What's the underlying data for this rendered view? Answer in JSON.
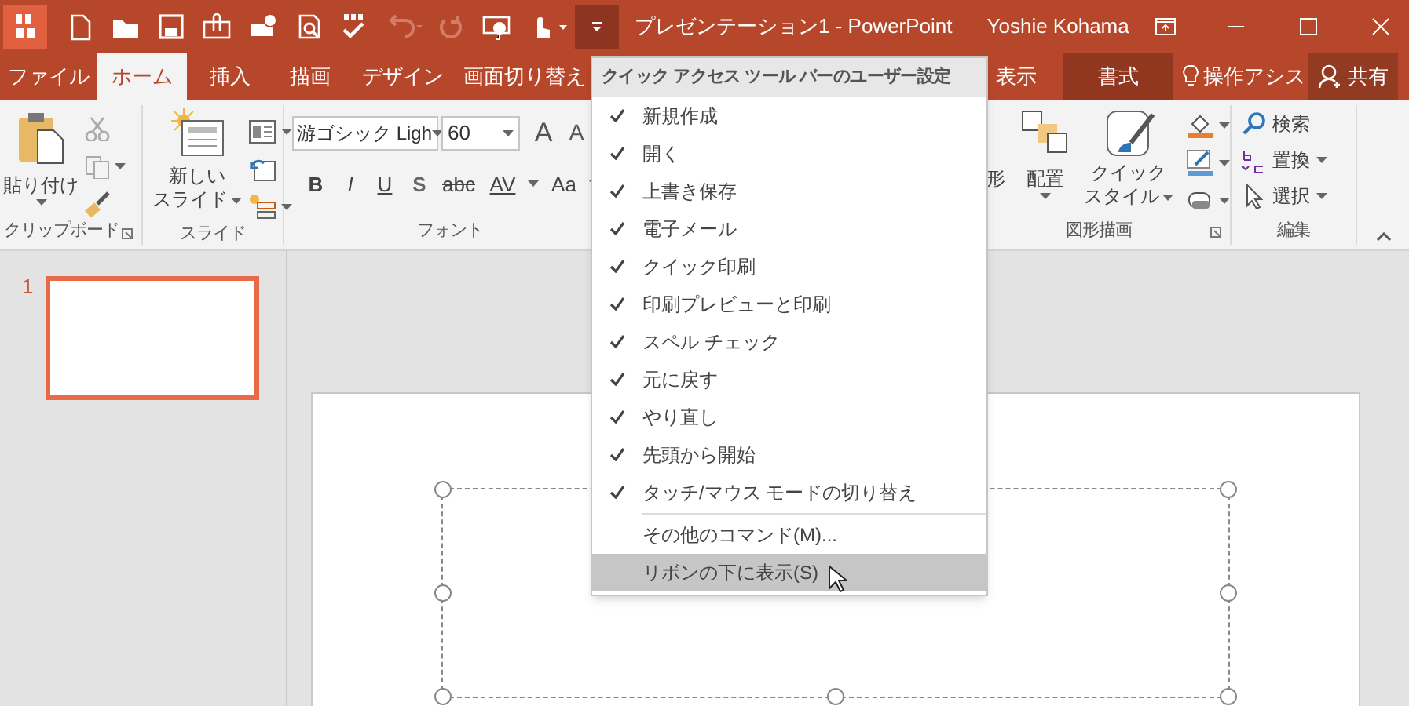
{
  "window": {
    "title": "プレゼンテーション1 - PowerPoint",
    "user": "Yoshie Kohama"
  },
  "quick_access": [
    {
      "kind": "addin",
      "disabled": false
    },
    {
      "kind": "new",
      "disabled": false
    },
    {
      "kind": "open",
      "disabled": false
    },
    {
      "kind": "save",
      "disabled": false
    },
    {
      "kind": "email",
      "disabled": false
    },
    {
      "kind": "quick_print",
      "disabled": false
    },
    {
      "kind": "print_preview",
      "disabled": false
    },
    {
      "kind": "spelling",
      "disabled": false
    },
    {
      "kind": "undo",
      "disabled": true
    },
    {
      "kind": "redo",
      "disabled": true
    },
    {
      "kind": "slideshow",
      "disabled": false
    },
    {
      "kind": "touch",
      "disabled": false
    }
  ],
  "customize_button": {
    "expanded": true
  },
  "tabs": [
    {
      "label": "ファイル",
      "selected": false,
      "kind": "normal"
    },
    {
      "label": "ホーム",
      "selected": true,
      "kind": "normal"
    },
    {
      "label": "挿入",
      "selected": false,
      "kind": "normal"
    },
    {
      "label": "描画",
      "selected": false,
      "kind": "normal"
    },
    {
      "label": "デザイン",
      "selected": false,
      "kind": "normal"
    },
    {
      "label": "画面切り替え",
      "selected": false,
      "kind": "normal"
    },
    {
      "label": "表示",
      "selected": false,
      "kind": "gap"
    },
    {
      "label": "書式",
      "selected": false,
      "kind": "contextual"
    }
  ],
  "tell_me": {
    "label": "操作アシス"
  },
  "share": {
    "label": "共有"
  },
  "clipboard": {
    "label": "クリップボード",
    "paste": "貼り付け",
    "tools": [
      {
        "kind": "cut",
        "disabled": true
      },
      {
        "kind": "copy",
        "disabled": true
      },
      {
        "kind": "format_painter",
        "disabled": false
      }
    ]
  },
  "slides_group": {
    "label": "スライド",
    "new_slide": [
      "新しい",
      "スライド"
    ]
  },
  "font": {
    "label": "フォント",
    "name": "游ゴシック Ligh",
    "size": "60",
    "grow": "A",
    "shrink": "A",
    "styles": [
      "B",
      "I",
      "U",
      "S",
      "abc",
      "AV",
      "Aa"
    ]
  },
  "drawing": {
    "label": "図形描画",
    "shapes": "形",
    "arrange": "配置",
    "quick_styles": [
      "クイック",
      "スタイル"
    ]
  },
  "editing": {
    "label": "編集",
    "find": "検索",
    "replace": "置換",
    "select": "選択"
  },
  "customize_menu": {
    "title": "クイック アクセス ツール バーのユーザー設定",
    "items": [
      {
        "label": "新規作成",
        "kind": "toggle",
        "checked": true,
        "highlighted": false
      },
      {
        "label": "開く",
        "kind": "toggle",
        "checked": true,
        "highlighted": false
      },
      {
        "label": "上書き保存",
        "kind": "toggle",
        "checked": true,
        "highlighted": false
      },
      {
        "label": "電子メール",
        "kind": "toggle",
        "checked": true,
        "highlighted": false
      },
      {
        "label": "クイック印刷",
        "kind": "toggle",
        "checked": true,
        "highlighted": false
      },
      {
        "label": "印刷プレビューと印刷",
        "kind": "toggle",
        "checked": true,
        "highlighted": false
      },
      {
        "label": "スペル チェック",
        "kind": "toggle",
        "checked": true,
        "highlighted": false
      },
      {
        "label": "元に戻す",
        "kind": "toggle",
        "checked": true,
        "highlighted": false
      },
      {
        "label": "やり直し",
        "kind": "toggle",
        "checked": true,
        "highlighted": false
      },
      {
        "label": "先頭から開始",
        "kind": "toggle",
        "checked": true,
        "highlighted": false
      },
      {
        "label": "タッチ/マウス モードの切り替え",
        "kind": "toggle",
        "checked": true,
        "highlighted": false
      },
      {
        "label": "その他のコマンド(M)...",
        "kind": "command",
        "highlighted": false
      },
      {
        "label": "リボンの下に表示(S)",
        "kind": "command",
        "highlighted": true
      }
    ]
  },
  "slides": [
    {
      "number": "1",
      "selected": true
    }
  ]
}
